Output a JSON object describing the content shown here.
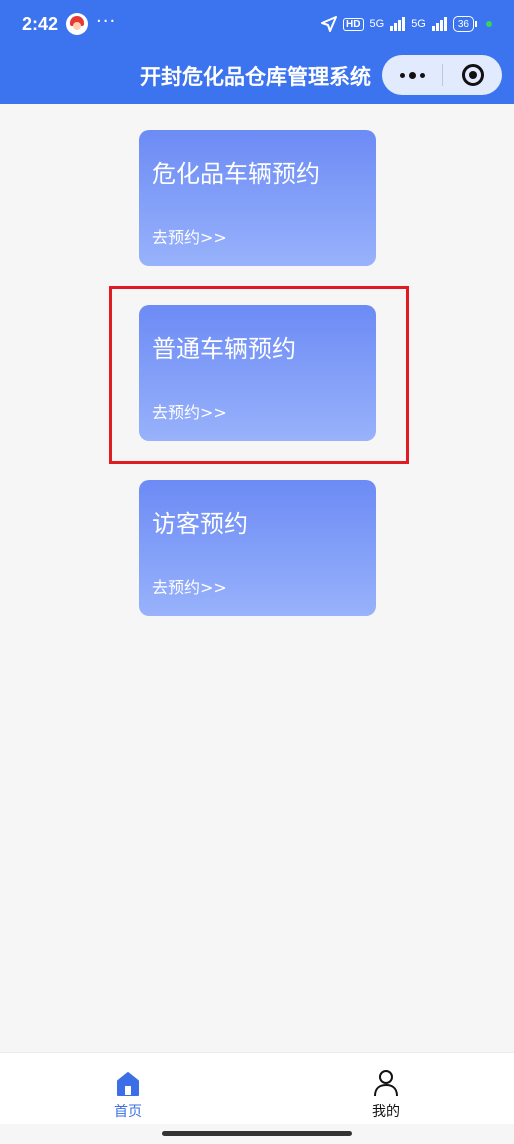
{
  "status_bar": {
    "time": "2:42",
    "more": "···",
    "hd": "HD",
    "net1": "5G",
    "net2": "5G",
    "battery": "36"
  },
  "header": {
    "title": "开封危化品仓库管理系统"
  },
  "cards": [
    {
      "title": "危化品车辆预约",
      "link": "去预约>>"
    },
    {
      "title": "普通车辆预约",
      "link": "去预约>>"
    },
    {
      "title": "访客预约",
      "link": "去预约>>"
    }
  ],
  "tabbar": {
    "home": "首页",
    "mine": "我的"
  },
  "colors": {
    "primary": "#3c74f0",
    "card_top": "#6c8bf5",
    "card_bottom": "#98b2fb",
    "highlight": "#e11b22",
    "page_bg": "#f6f6f6"
  }
}
